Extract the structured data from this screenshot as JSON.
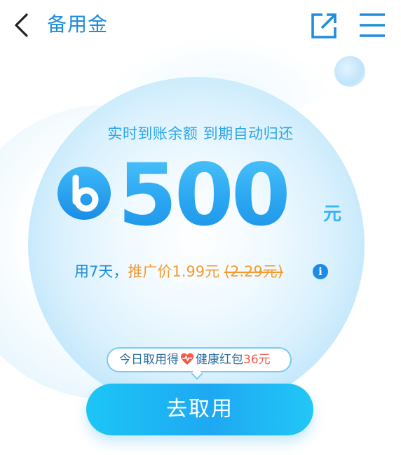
{
  "header": {
    "title": "备用金",
    "back_icon": "chevron-left-icon",
    "share_icon": "external-link-icon",
    "menu_icon": "menu-icon"
  },
  "offer": {
    "subtitle": "实时到账余额 到期自动归还",
    "amount": "500",
    "unit": "元",
    "duration_text": "用7天，",
    "promo_label": "推广价",
    "promo_price": "1.99元",
    "original_price": "(2.29元)"
  },
  "reward": {
    "prefix": "今日取用得",
    "name": "健康红包",
    "amount": "36元"
  },
  "cta": {
    "label": "去取用"
  },
  "colors": {
    "primary_blue": "#1f8ddd",
    "accent_orange": "#f49a2e",
    "reward_red": "#f25a4a",
    "button_gradient_start": "#1cc6f6",
    "button_gradient_mid": "#1ea8f2"
  }
}
